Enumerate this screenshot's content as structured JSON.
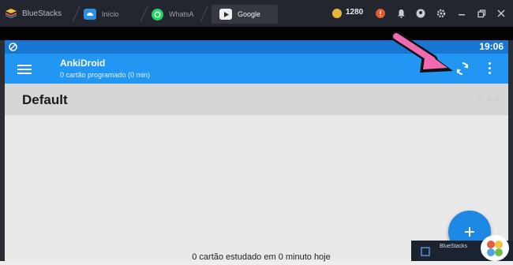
{
  "window": {
    "app_name": "BlueStacks",
    "tabs": [
      {
        "label": "Início",
        "icon": "home-icon"
      },
      {
        "label": "WhatsA",
        "icon": "whatsapp-icon"
      },
      {
        "label": "Google",
        "icon": "play-store-icon"
      }
    ],
    "coins": "1280",
    "controls": [
      "alert-icon",
      "notification-bell-icon",
      "account-icon",
      "settings-gear-icon",
      "minimize-icon",
      "restore-icon",
      "close-icon"
    ]
  },
  "statusbar": {
    "time": "19:06"
  },
  "appbar": {
    "title": "AnkiDroid",
    "subtitle": "0 cartão programado (0 min)"
  },
  "deck": {
    "name": "Default",
    "counts": [
      "0",
      "0",
      "0"
    ]
  },
  "footer": {
    "text": "0 cartão estudado em 0 minuto hoje"
  },
  "toast": {
    "label": "BlueStacks"
  },
  "colors": {
    "appbar": "#2196f3",
    "statusbar": "#1976d2",
    "fab": "#1e88e5",
    "arrow": "#f06ab0"
  }
}
